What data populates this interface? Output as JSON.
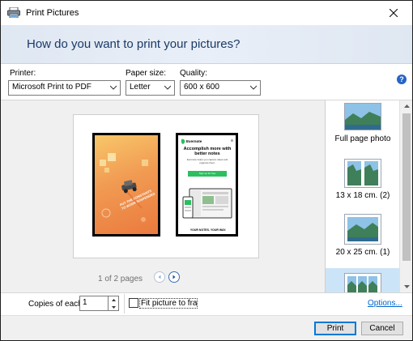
{
  "window": {
    "title": "Print Pictures"
  },
  "header": {
    "question": "How do you want to print your pictures?"
  },
  "printer": {
    "label": "Printer:",
    "value": "Microsoft Print to PDF"
  },
  "paper_size": {
    "label": "Paper size:",
    "value": "Letter"
  },
  "quality": {
    "label": "Quality:",
    "value": "600 x 600"
  },
  "help": {
    "glyph": "?"
  },
  "preview": {
    "page_indicator": "1 of 2 pages",
    "photo1": {
      "caption_lines": [
        "PUT THE CONSTANTS",
        "TO WORK SUSPENDED"
      ]
    },
    "photo2": {
      "brand": "Evernote",
      "headline": "Accomplish more with better notes",
      "body": "Evernote helps you capture ideas and organize them.",
      "cta": "Sign up for free",
      "footer": "YOUR NOTES. YOUR WAY."
    }
  },
  "layouts": [
    {
      "label": "Full page photo",
      "selected": false
    },
    {
      "label": "13 x 18 cm. (2)",
      "selected": false
    },
    {
      "label": "20 x 25 cm. (1)",
      "selected": false
    },
    {
      "label": "",
      "selected": true
    }
  ],
  "copies": {
    "label": "Copies of each",
    "value": "1"
  },
  "fit": {
    "label": "Fit picture to frame",
    "checked": false
  },
  "options_link": "Options...",
  "buttons": {
    "print": "Print",
    "cancel": "Cancel"
  },
  "colors": {
    "accent": "#0078d7",
    "header_text": "#1a3a66",
    "link": "#0066cc"
  }
}
